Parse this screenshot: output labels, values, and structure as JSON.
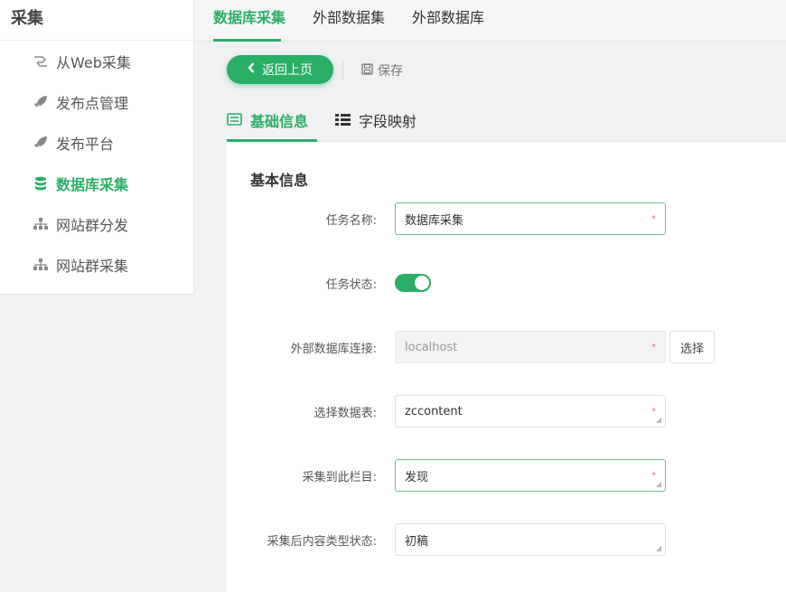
{
  "sidebar": {
    "title": "采集",
    "items": [
      {
        "label": "从Web采集",
        "icon": "web-collect-icon",
        "active": false
      },
      {
        "label": "发布点管理",
        "icon": "rocket-icon",
        "active": false
      },
      {
        "label": "发布平台",
        "icon": "rocket-icon",
        "active": false
      },
      {
        "label": "数据库采集",
        "icon": "database-icon",
        "active": true
      },
      {
        "label": "网站群分发",
        "icon": "sitemap-icon",
        "active": false
      },
      {
        "label": "网站群采集",
        "icon": "sitemap-icon",
        "active": false
      }
    ]
  },
  "top_tabs": [
    {
      "label": "数据库采集",
      "active": true
    },
    {
      "label": "外部数据集",
      "active": false
    },
    {
      "label": "外部数据库",
      "active": false
    }
  ],
  "toolbar": {
    "back_label": "返回上页",
    "save_label": "保存"
  },
  "sub_tabs": [
    {
      "label": "基础信息",
      "icon": "list-card-icon",
      "active": true
    },
    {
      "label": "字段映射",
      "icon": "list-icon",
      "active": false
    }
  ],
  "form": {
    "section_title": "基本信息",
    "task_name": {
      "label": "任务名称:",
      "value": "数据库采集",
      "required_mark": "*"
    },
    "task_status": {
      "label": "任务状态:",
      "enabled": true
    },
    "ext_db_conn": {
      "label": "外部数据库连接:",
      "value": "localhost",
      "required_mark": "*",
      "select_label": "选择"
    },
    "table": {
      "label": "选择数据表:",
      "value": "zccontent",
      "required_mark": "*"
    },
    "target_column": {
      "label": "采集到此栏目:",
      "value": "发现",
      "required_mark": "*"
    },
    "content_status": {
      "label": "采集后内容类型状态:",
      "value": "初稿"
    }
  },
  "colors": {
    "accent": "#2bae66"
  }
}
